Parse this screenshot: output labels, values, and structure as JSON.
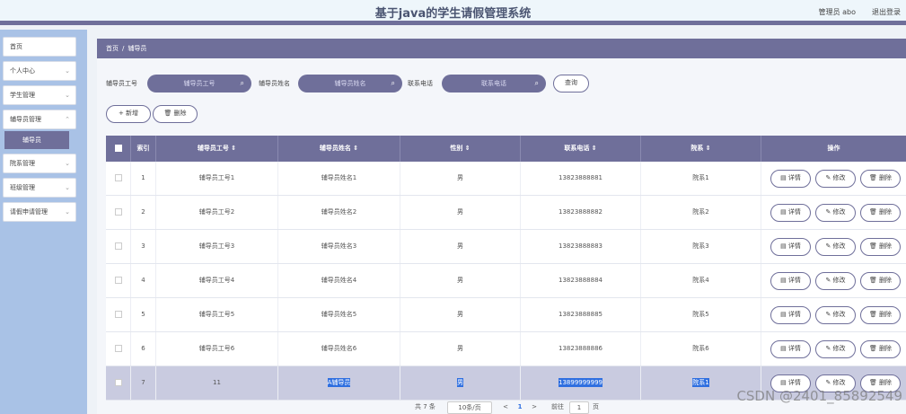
{
  "header": {
    "title": "基于java的学生请假管理系统",
    "user": "管理员 abo",
    "logout": "退出登录"
  },
  "sidebar": {
    "items": [
      {
        "label": "首页",
        "chev": ""
      },
      {
        "label": "个人中心",
        "chev": "⌄"
      },
      {
        "label": "学生管理",
        "chev": "⌄"
      },
      {
        "label": "辅导员管理",
        "chev": "⌃"
      },
      {
        "label": "院系管理",
        "chev": "⌄"
      },
      {
        "label": "班级管理",
        "chev": "⌄"
      },
      {
        "label": "请假申请管理",
        "chev": "⌄"
      }
    ],
    "sub": "辅导员"
  },
  "breadcrumb": {
    "home": "首页",
    "sep": "/",
    "current": "辅导员"
  },
  "search": {
    "label1": "辅导员工号",
    "placeholder1": "辅导员工号",
    "label2": "辅导员姓名",
    "placeholder2": "辅导员姓名",
    "label3": "联系电话",
    "placeholder3": "联系电话",
    "button": "查询",
    "icon": "⌕"
  },
  "toolbar": {
    "add": "+ 新增",
    "delete": "🗑 删除"
  },
  "table": {
    "headers": [
      "索引",
      "辅导员工号 ⇕",
      "辅导员姓名 ⇕",
      "性别 ⇕",
      "联系电话 ⇕",
      "院系 ⇕",
      "操作"
    ],
    "rows": [
      {
        "idx": "1",
        "id": "辅导员工号1",
        "name": "辅导员姓名1",
        "sex": "男",
        "phone": "13823888881",
        "dept": "院系1"
      },
      {
        "idx": "2",
        "id": "辅导员工号2",
        "name": "辅导员姓名2",
        "sex": "男",
        "phone": "13823888882",
        "dept": "院系2"
      },
      {
        "idx": "3",
        "id": "辅导员工号3",
        "name": "辅导员姓名3",
        "sex": "男",
        "phone": "13823888883",
        "dept": "院系3"
      },
      {
        "idx": "4",
        "id": "辅导员工号4",
        "name": "辅导员姓名4",
        "sex": "男",
        "phone": "13823888884",
        "dept": "院系4"
      },
      {
        "idx": "5",
        "id": "辅导员工号5",
        "name": "辅导员姓名5",
        "sex": "男",
        "phone": "13823888885",
        "dept": "院系5"
      },
      {
        "idx": "6",
        "id": "辅导员工号6",
        "name": "辅导员姓名6",
        "sex": "男",
        "phone": "13823888886",
        "dept": "院系6"
      },
      {
        "idx": "7",
        "id": "11",
        "name": "A辅导员",
        "sex": "男",
        "phone": "13899999999",
        "dept": "院系1"
      }
    ],
    "actions": {
      "detail": "▤ 详情",
      "edit": "✎ 修改",
      "delete": "🗑 删除"
    }
  },
  "pager": {
    "total": "共 7 条",
    "size": "10条/页",
    "prev": "<",
    "page": "1",
    "next": ">",
    "goto": "前往",
    "goto_val": "1",
    "unit": "页"
  },
  "watermark": "CSDN @2401_85892549"
}
